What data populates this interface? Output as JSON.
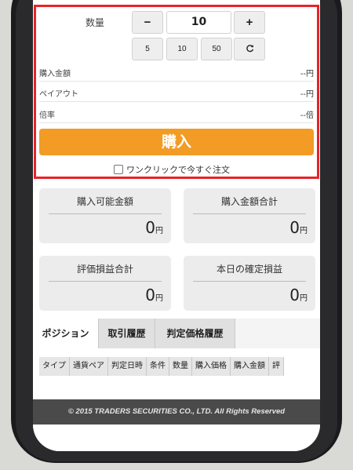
{
  "order": {
    "quantity_label": "数量",
    "minus_label": "−",
    "quantity_value": "10",
    "plus_label": "+",
    "presets": [
      "5",
      "10",
      "50"
    ],
    "reset_icon": "refresh-icon",
    "purchase_amount_label": "購入金額",
    "purchase_amount_value": "--円",
    "payout_label": "ペイアウト",
    "payout_value": "--円",
    "multiplier_label": "倍率",
    "multiplier_value": "--倍",
    "buy_label": "購入",
    "oneclick_label": "ワンクリックで今すぐ注文"
  },
  "summary": {
    "cards": [
      {
        "title": "購入可能金額",
        "value": "0",
        "unit": "円"
      },
      {
        "title": "購入金額合計",
        "value": "0",
        "unit": "円"
      },
      {
        "title": "評価損益合計",
        "value": "0",
        "unit": "円"
      },
      {
        "title": "本日の確定損益",
        "value": "0",
        "unit": "円"
      }
    ]
  },
  "tabs": [
    "ポジション",
    "取引履歴",
    "判定価格履歴"
  ],
  "table": {
    "columns": [
      "タイプ",
      "通貨ペア",
      "判定日時",
      "条件",
      "数量",
      "購入価格",
      "購入金額",
      "評"
    ]
  },
  "footer": {
    "copyright": "© 2015 TRADERS SECURITIES CO., LTD. All Rights Reserved"
  },
  "colors": {
    "accent": "#f29b25",
    "highlight": "#e8232a"
  }
}
